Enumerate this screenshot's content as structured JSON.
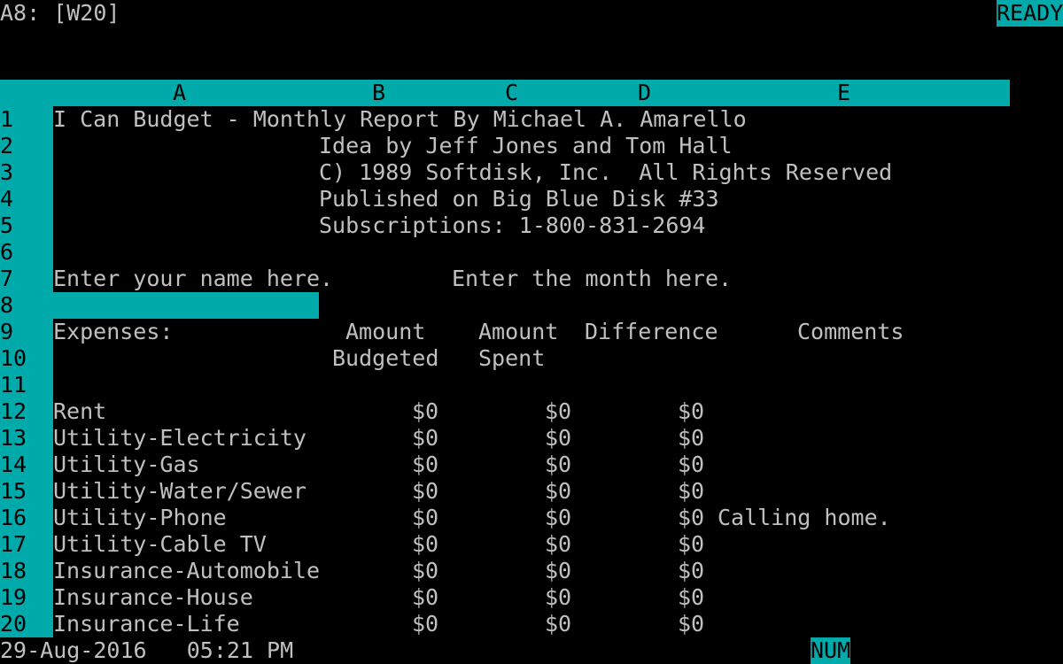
{
  "status_line": {
    "cell_ref": "A8: [W20]",
    "mode": "READY"
  },
  "columns": [
    "A",
    "B",
    "C",
    "D",
    "E"
  ],
  "row_numbers": [
    "1",
    "2",
    "3",
    "4",
    "5",
    "6",
    "7",
    "8",
    "9",
    "10",
    "11",
    "12",
    "13",
    "14",
    "15",
    "16",
    "17",
    "18",
    "19",
    "20"
  ],
  "header_lines": [
    "I Can Budget - Monthly Report By Michael A. Amarello",
    "Idea by Jeff Jones and Tom Hall",
    "C) 1989 Softdisk, Inc.  All Rights Reserved",
    "Published on Big Blue Disk #33",
    "Subscriptions: 1-800-831-2694"
  ],
  "prompts": {
    "name": "Enter your name here.",
    "month": "Enter the month here."
  },
  "table_headers": {
    "expenses": "Expenses:",
    "amount1": "Amount",
    "budgeted": "Budgeted",
    "amount2": "Amount",
    "spent": "Spent",
    "difference": "Difference",
    "comments": "Comments"
  },
  "expenses": [
    {
      "name": "Rent",
      "budgeted": "$0",
      "spent": "$0",
      "difference": "$0",
      "comment": ""
    },
    {
      "name": "Utility-Electricity",
      "budgeted": "$0",
      "spent": "$0",
      "difference": "$0",
      "comment": ""
    },
    {
      "name": "Utility-Gas",
      "budgeted": "$0",
      "spent": "$0",
      "difference": "$0",
      "comment": ""
    },
    {
      "name": "Utility-Water/Sewer",
      "budgeted": "$0",
      "spent": "$0",
      "difference": "$0",
      "comment": ""
    },
    {
      "name": "Utility-Phone",
      "budgeted": "$0",
      "spent": "$0",
      "difference": "$0",
      "comment": "Calling home."
    },
    {
      "name": "Utility-Cable TV",
      "budgeted": "$0",
      "spent": "$0",
      "difference": "$0",
      "comment": ""
    },
    {
      "name": "Insurance-Automobile",
      "budgeted": "$0",
      "spent": "$0",
      "difference": "$0",
      "comment": ""
    },
    {
      "name": "Insurance-House",
      "budgeted": "$0",
      "spent": "$0",
      "difference": "$0",
      "comment": ""
    },
    {
      "name": "Insurance-Life",
      "budgeted": "$0",
      "spent": "$0",
      "difference": "$0",
      "comment": ""
    }
  ],
  "bottom_line": {
    "datetime": "29-Aug-2016   05:21 PM",
    "num": "NUM"
  },
  "colors": {
    "highlight": "#00aaaa",
    "text": "#c0c0c0",
    "background": "#000000"
  }
}
